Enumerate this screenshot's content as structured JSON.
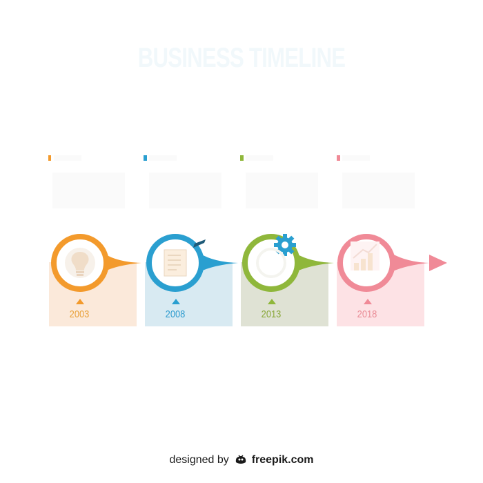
{
  "title": "BUSINESS TIMELINE",
  "milestones": [
    {
      "year": "2003",
      "icon": "lightbulb-icon",
      "color": "#f39a2c",
      "panel": "#fbe9da",
      "text": "#e9a23b"
    },
    {
      "year": "2008",
      "icon": "notepad-pencil-icon",
      "color": "#2a9fd0",
      "panel": "#d8eaf2",
      "text": "#2f9ccf"
    },
    {
      "year": "2013",
      "icon": "gear-icon",
      "color": "#8fb73b",
      "panel": "#dfe2d4",
      "text": "#8aa83a"
    },
    {
      "year": "2018",
      "icon": "growth-chart-icon",
      "color": "#f08a97",
      "panel": "#fde2e5",
      "text": "#ea8c96"
    }
  ],
  "credit": {
    "prefix": "designed by",
    "brand": "freepik.com"
  }
}
